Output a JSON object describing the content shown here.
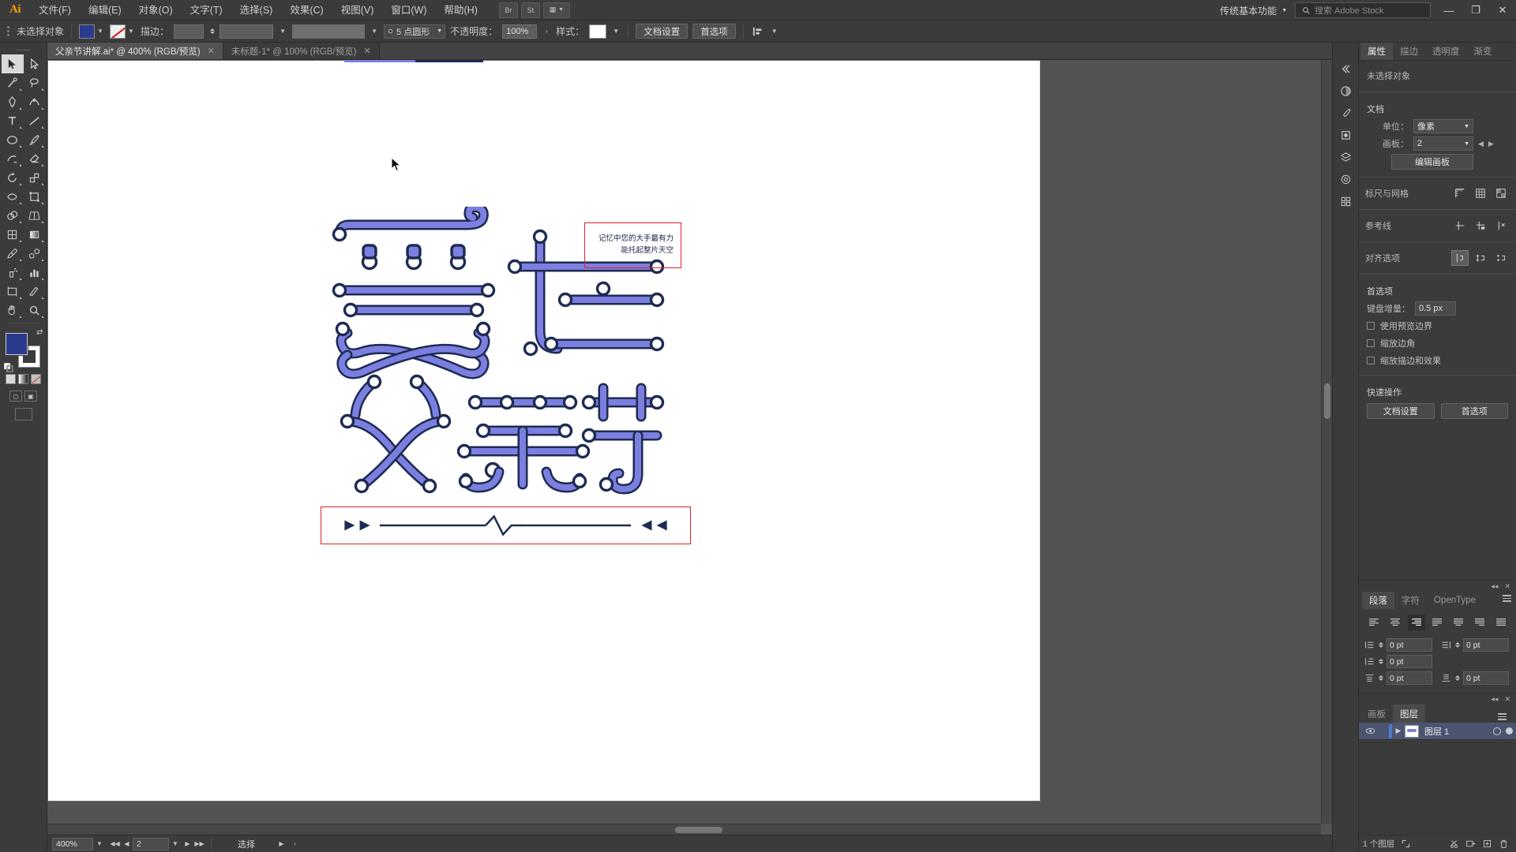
{
  "app": {
    "logo": "Ai",
    "workspace": "传统基本功能",
    "stock_placeholder": "搜索 Adobe Stock",
    "window_controls": {
      "minimize": "—",
      "maximize": "❐",
      "close": "✕"
    }
  },
  "menu": {
    "items": [
      {
        "label": "文件(F)"
      },
      {
        "label": "编辑(E)"
      },
      {
        "label": "对象(O)"
      },
      {
        "label": "文字(T)"
      },
      {
        "label": "选择(S)"
      },
      {
        "label": "效果(C)"
      },
      {
        "label": "视图(V)"
      },
      {
        "label": "窗口(W)"
      },
      {
        "label": "帮助(H)"
      }
    ],
    "icons": [
      {
        "name": "bridge-icon",
        "glyph": "Br"
      },
      {
        "name": "stock-icon",
        "glyph": "St"
      },
      {
        "name": "arrange-documents-icon",
        "glyph": "▦"
      }
    ]
  },
  "controlbar": {
    "selection_status": "未选择对象",
    "fill_color": "#2b3a8f",
    "stroke_color": "none",
    "stroke_label": "描边：",
    "stroke_weight": "",
    "brush_definition": "",
    "stroke_profile": "5 点圆形",
    "opacity_label": "不透明度：",
    "opacity_value": "100%",
    "style_label": "样式：",
    "doc_setup_button": "文档设置",
    "preferences_button": "首选项",
    "align_label": "对齐"
  },
  "toolbox": {
    "tools": [
      {
        "name": "selection-tool",
        "label": "选择工具",
        "active": true
      },
      {
        "name": "direct-selection-tool",
        "label": "直接选择工具"
      },
      {
        "name": "magic-wand-tool",
        "label": "魔棒工具"
      },
      {
        "name": "lasso-tool",
        "label": "套索工具"
      },
      {
        "name": "pen-tool",
        "label": "钢笔工具"
      },
      {
        "name": "curvature-tool",
        "label": "曲率工具"
      },
      {
        "name": "type-tool",
        "label": "文字工具"
      },
      {
        "name": "line-segment-tool",
        "label": "直线段工具"
      },
      {
        "name": "ellipse-tool",
        "label": "椭圆工具"
      },
      {
        "name": "paintbrush-tool",
        "label": "画笔工具"
      },
      {
        "name": "shaper-tool",
        "label": "Shaper 工具"
      },
      {
        "name": "eraser-tool",
        "label": "橡皮擦工具"
      },
      {
        "name": "rotate-tool",
        "label": "旋转工具"
      },
      {
        "name": "scale-tool",
        "label": "比例缩放工具"
      },
      {
        "name": "width-tool",
        "label": "宽度工具"
      },
      {
        "name": "free-transform-tool",
        "label": "自由变换工具"
      },
      {
        "name": "shape-builder-tool",
        "label": "形状生成器工具"
      },
      {
        "name": "perspective-grid-tool",
        "label": "透视网格工具"
      },
      {
        "name": "mesh-tool",
        "label": "网格工具"
      },
      {
        "name": "gradient-tool",
        "label": "渐变工具"
      },
      {
        "name": "eyedropper-tool",
        "label": "吸管工具"
      },
      {
        "name": "blend-tool",
        "label": "混合工具"
      },
      {
        "name": "symbol-sprayer-tool",
        "label": "符号喷枪工具"
      },
      {
        "name": "column-graph-tool",
        "label": "柱形图工具"
      },
      {
        "name": "artboard-tool",
        "label": "画板工具"
      },
      {
        "name": "slice-tool",
        "label": "切片工具"
      },
      {
        "name": "hand-tool",
        "label": "抓手工具"
      },
      {
        "name": "zoom-tool",
        "label": "缩放工具"
      }
    ],
    "fill_color": "#2b3a8f",
    "stroke_color": "#ffffff",
    "paint_modes": [
      "color-mode",
      "gradient-mode",
      "none-mode"
    ],
    "screen_modes": [
      "normal-screen-mode",
      "full-screen-mode"
    ]
  },
  "documents": {
    "tabs": [
      {
        "label": "父亲节讲解.ai* @ 400% (RGB/预览)",
        "active": true,
        "close": "✕"
      },
      {
        "label": "未标题-1* @ 100% (RGB/预览)",
        "active": false,
        "close": "✕"
      }
    ]
  },
  "canvas": {
    "annotation_text_line1": "记忆中您的大手最有力",
    "annotation_text_line2": "能托起整片天空",
    "annotation_border_color": "#e0202a",
    "artwork_fill": "#7b7fe0",
    "artwork_stroke": "#1e2b52",
    "artwork_title": "爱在父亲节",
    "divider_color": "#1e2b52",
    "background": "#535353",
    "artboard_background": "#ffffff"
  },
  "statusbar": {
    "zoom": "400%",
    "artboard_number": "2",
    "status_text": "选择",
    "nav_first": "◀◀",
    "nav_prev": "◀",
    "nav_next": "▶",
    "nav_last": "▶▶"
  },
  "rightdock": {
    "icons": [
      {
        "name": "color-panel-icon"
      },
      {
        "name": "brushes-panel-icon"
      },
      {
        "name": "symbols-panel-icon"
      },
      {
        "name": "layers-panel-icon"
      },
      {
        "name": "appearance-panel-icon"
      },
      {
        "name": "libraries-panel-icon"
      }
    ]
  },
  "properties_panel": {
    "tabs": [
      {
        "label": "属性",
        "active": true
      },
      {
        "label": "描边",
        "active": false
      },
      {
        "label": "透明度",
        "active": false
      },
      {
        "label": "渐变",
        "active": false
      }
    ],
    "no_selection": "未选择对象",
    "document_section": "文档",
    "unit_label": "单位：",
    "unit_value": "像素",
    "artboard_label": "画板：",
    "artboard_value": "2",
    "edit_artboards_button": "编辑画板",
    "rulers_grid_label": "标尺与网格",
    "guides_label": "参考线",
    "snap_label": "对齐选项",
    "preferences_section": "首选项",
    "keyboard_increment_label": "键盘增量：",
    "keyboard_increment_value": "0.5 px",
    "checkboxes": [
      {
        "label": "使用预览边界",
        "checked": false
      },
      {
        "label": "缩放边角",
        "checked": false
      },
      {
        "label": "缩放描边和效果",
        "checked": false
      }
    ],
    "quick_actions_label": "快速操作",
    "quick_actions": [
      {
        "label": "文档设置"
      },
      {
        "label": "首选项"
      }
    ]
  },
  "paragraph_panel": {
    "tabs": [
      {
        "label": "段落",
        "active": true
      },
      {
        "label": "字符",
        "active": false
      },
      {
        "label": "OpenType",
        "active": false
      }
    ],
    "alignments": [
      {
        "name": "align-left",
        "selected": false
      },
      {
        "name": "align-center",
        "selected": false
      },
      {
        "name": "align-right",
        "selected": true
      },
      {
        "name": "justify-last-left",
        "selected": false
      },
      {
        "name": "justify-last-center",
        "selected": false
      },
      {
        "name": "justify-last-right",
        "selected": false
      },
      {
        "name": "justify-all",
        "selected": false
      }
    ],
    "fields": [
      {
        "name": "left-indent",
        "value": "0 pt"
      },
      {
        "name": "right-indent",
        "value": "0 pt"
      },
      {
        "name": "first-line-indent",
        "value": "0 pt"
      },
      {
        "name": "space-before",
        "value": "0 pt"
      },
      {
        "name": "space-after",
        "value": "0 pt"
      }
    ]
  },
  "layers_panel": {
    "tabs": [
      {
        "label": "画板",
        "active": false
      },
      {
        "label": "图层",
        "active": true
      }
    ],
    "layers": [
      {
        "name": "图层 1",
        "visible": true,
        "selected": true
      }
    ],
    "count_text": "1 个图层",
    "footer_icons": [
      {
        "name": "locate-object-icon"
      },
      {
        "name": "make-clipping-mask-icon"
      },
      {
        "name": "create-sublayer-icon"
      },
      {
        "name": "new-layer-icon"
      },
      {
        "name": "delete-layer-icon"
      }
    ]
  }
}
